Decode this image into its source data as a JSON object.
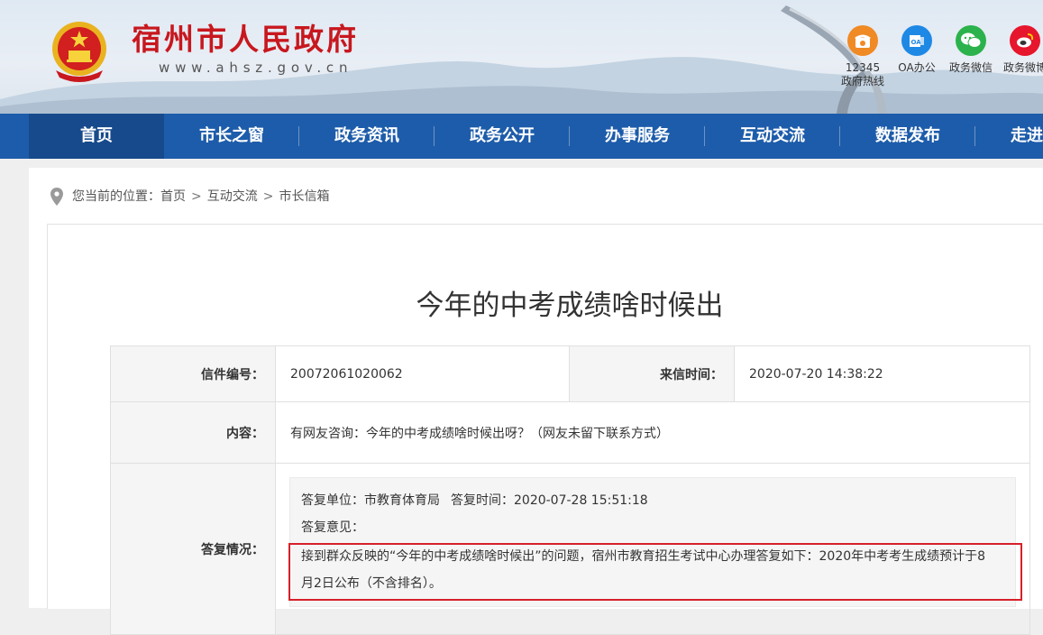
{
  "header": {
    "site_title": "宿州市人民政府",
    "site_url": "www.ahsz.gov.cn",
    "quick_links": [
      {
        "label": "12345\n政府热线",
        "icon": "phone-icon",
        "color": "#f08a24"
      },
      {
        "label": "OA办公",
        "icon": "oa-icon",
        "color": "#1e88e5"
      },
      {
        "label": "政务微信",
        "icon": "wechat-icon",
        "color": "#2bb24c"
      },
      {
        "label": "政务微博",
        "icon": "weibo-icon",
        "color": "#e6162d"
      }
    ]
  },
  "nav": {
    "items": [
      "首页",
      "市长之窗",
      "政务资讯",
      "政务公开",
      "办事服务",
      "互动交流",
      "数据发布",
      "走进宿州"
    ],
    "active_index": 0
  },
  "breadcrumb": {
    "prefix": "您当前的位置：",
    "items": [
      "首页",
      "互动交流",
      "市长信箱"
    ],
    "separator": ">"
  },
  "letter": {
    "title": "今年的中考成绩啥时候出",
    "number_label": "信件编号：",
    "number": "20072061020062",
    "time_label": "来信时间：",
    "time": "2020-07-20 14:38:22",
    "content_label": "内容：",
    "content": "有网友咨询：今年的中考成绩啥时候出呀？（网友未留下联系方式）",
    "reply_label": "答复情况：",
    "reply_unit": "答复单位：市教育体育局",
    "reply_time": "答复时间：2020-07-28 15:51:18",
    "reply_opinion_label": "答复意见：",
    "reply_text": "接到群众反映的“今年的中考成绩啥时候出”的问题，宿州市教育招生考试中心办理答复如下：2020年中考考生成绩预计于8月2日公布（不含排名）。"
  },
  "colors": {
    "brand_red": "#c8171e",
    "nav_blue": "#1d5caa",
    "nav_active": "#174a8c",
    "highlight_red": "#d6202a"
  }
}
